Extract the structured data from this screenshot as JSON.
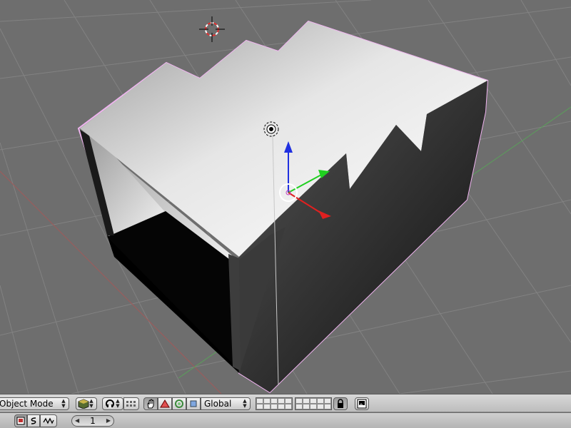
{
  "window": {
    "view": "3D View",
    "object_color": "#b9b9b9",
    "selection_outline": "#f0b4f0",
    "axis_x_color": "#e02020",
    "axis_y_color": "#20d020",
    "axis_z_color": "#2030e0"
  },
  "header": {
    "mode_label": "Object Mode",
    "draw_type_icon": "solid-cube-icon",
    "pivot_icon": "pivot-point-icon",
    "snap_icon": "snap-icon",
    "manipulator_icons": [
      "hand-icon",
      "translate-triangle-icon",
      "rotate-circle-icon",
      "scale-square-icon"
    ],
    "orientation_label": "Global",
    "lock_icon": "lock-icon",
    "render_icon": "render-image-icon"
  },
  "bottom": {
    "buttons": [
      "image-icon",
      "curve-s-icon",
      "wave-icon"
    ],
    "frame_value": "1"
  }
}
